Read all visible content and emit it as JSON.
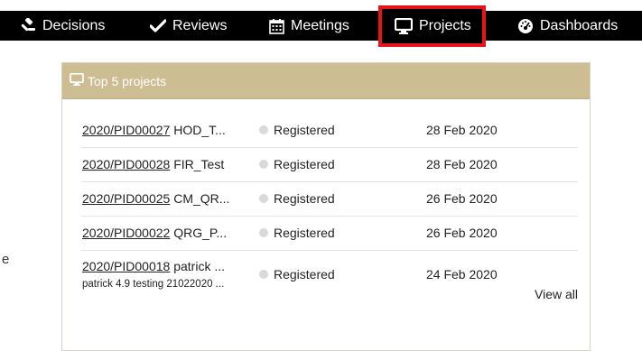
{
  "nav": {
    "items": [
      {
        "label": "Decisions",
        "icon": "gavel-icon"
      },
      {
        "label": "Reviews",
        "icon": "checkmark-icon"
      },
      {
        "label": "Meetings",
        "icon": "calendar-icon"
      },
      {
        "label": "Projects",
        "icon": "monitor-icon",
        "active": true
      },
      {
        "label": "Dashboards",
        "icon": "dashboard-gauge-icon"
      }
    ],
    "active_color": "#e8141b"
  },
  "left_fragment": "e",
  "panel": {
    "title": "Top 5 projects",
    "header_color": "#cdbd93",
    "rows": [
      {
        "pid": "2020/PID00027",
        "name": "HOD_T...",
        "status": "Registered",
        "date": "28 Feb 2020"
      },
      {
        "pid": "2020/PID00028",
        "name": "FIR_Test",
        "status": "Registered",
        "date": "28 Feb 2020"
      },
      {
        "pid": "2020/PID00025",
        "name": "CM_QR...",
        "status": "Registered",
        "date": "26 Feb 2020"
      },
      {
        "pid": "2020/PID00022",
        "name": "QRG_P...",
        "status": "Registered",
        "date": "26 Feb 2020"
      },
      {
        "pid": "2020/PID00018",
        "name": "patrick ...",
        "subtext": "patrick 4.9 testing 21022020 ...",
        "status": "Registered",
        "date": "24 Feb 2020"
      }
    ],
    "view_all_label": "View all"
  }
}
